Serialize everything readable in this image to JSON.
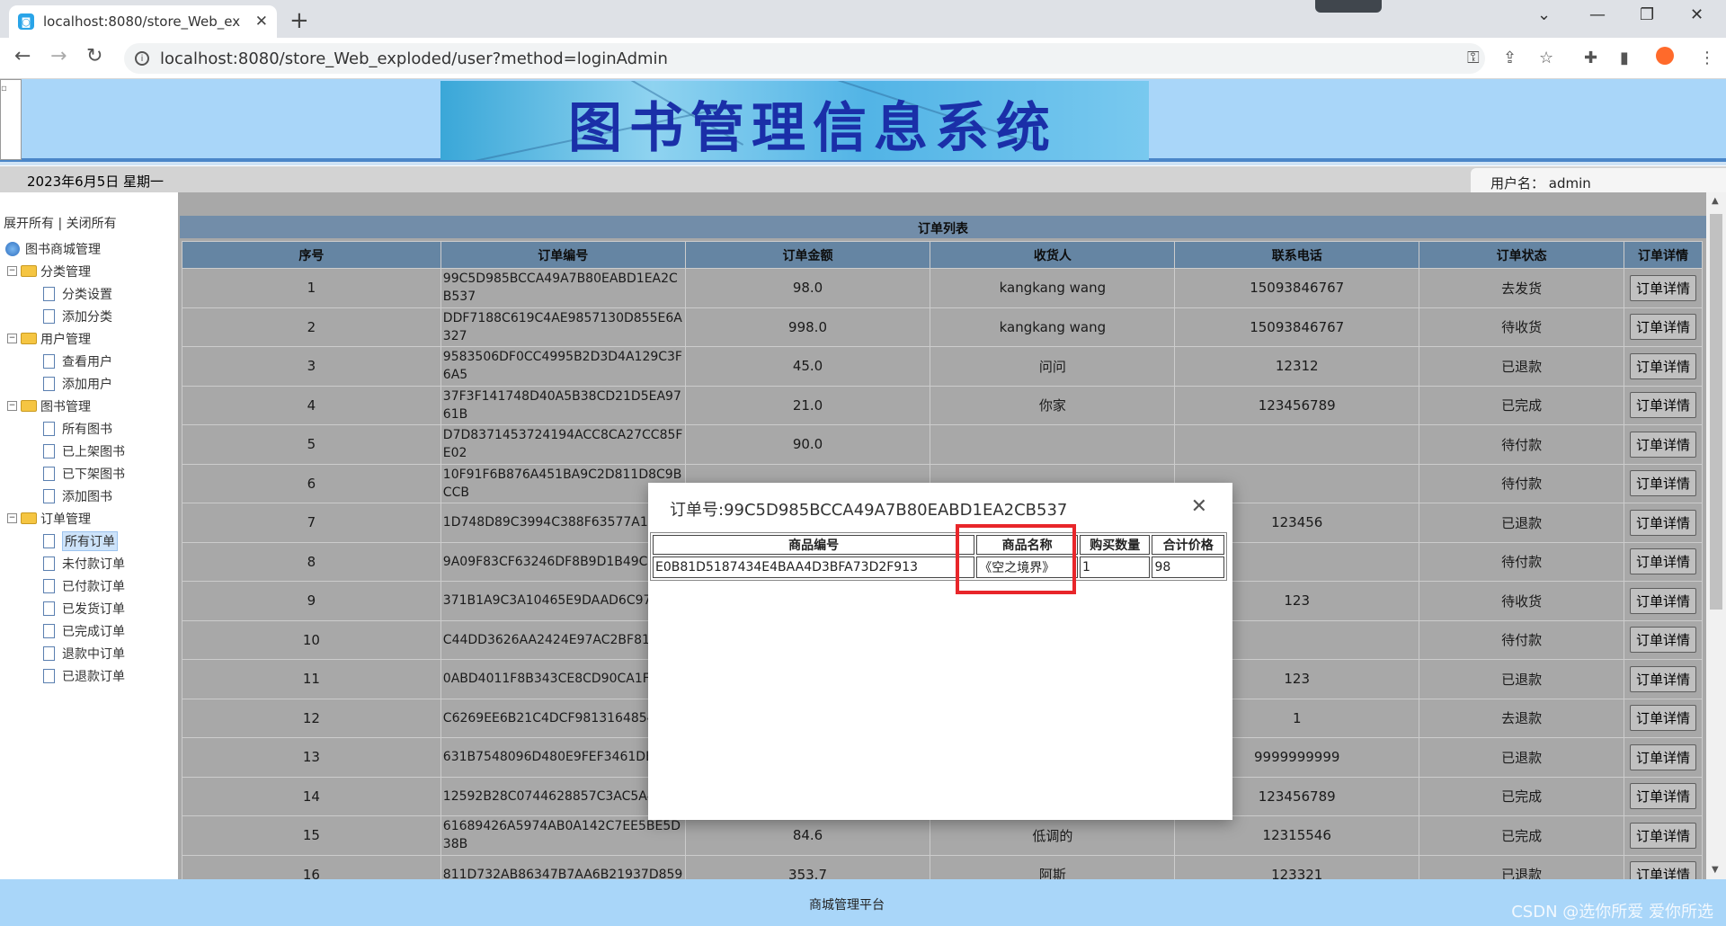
{
  "browser": {
    "tab_title": "localhost:8080/store_Web_exp",
    "url": "localhost:8080/store_Web_exploded/user?method=loginAdmin"
  },
  "header": {
    "banner_title": "图书管理信息系统",
    "date": "2023年6月5日 星期一",
    "user_label": "用户名：",
    "username": "admin"
  },
  "sidebar": {
    "expand_all": "展开所有",
    "separator": "|",
    "collapse_all": "关闭所有",
    "root": "图书商城管理",
    "groups": [
      {
        "label": "分类管理",
        "items": [
          "分类设置",
          "添加分类"
        ]
      },
      {
        "label": "用户管理",
        "items": [
          "查看用户",
          "添加用户"
        ]
      },
      {
        "label": "图书管理",
        "items": [
          "所有图书",
          "已上架图书",
          "已下架图书",
          "添加图书"
        ]
      },
      {
        "label": "订单管理",
        "items": [
          "所有订单",
          "未付款订单",
          "已付款订单",
          "已发货订单",
          "已完成订单",
          "退款中订单",
          "已退款订单"
        ]
      }
    ]
  },
  "orders": {
    "title": "订单列表",
    "columns": [
      "序号",
      "订单编号",
      "订单金额",
      "收货人",
      "联系电话",
      "订单状态",
      "订单详情"
    ],
    "detail_button": "订单详情",
    "rows": [
      {
        "no": "1",
        "id": "99C5D985BCCA49A7B80EABD1EA2CB537",
        "amount": "98.0",
        "receiver": "kangkang wang",
        "phone": "15093846767",
        "status": "去发货"
      },
      {
        "no": "2",
        "id": "DDF7188C619C4AE9857130D855E6A327",
        "amount": "998.0",
        "receiver": "kangkang wang",
        "phone": "15093846767",
        "status": "待收货"
      },
      {
        "no": "3",
        "id": "9583506DF0CC4995B2D3D4A129C3F6A5",
        "amount": "45.0",
        "receiver": "问问",
        "phone": "12312",
        "status": "已退款"
      },
      {
        "no": "4",
        "id": "37F3F141748D40A5B38CD21D5EA9761B",
        "amount": "21.0",
        "receiver": "你家",
        "phone": "123456789",
        "status": "已完成"
      },
      {
        "no": "5",
        "id": "D7D8371453724194ACC8CA27CC85FE02",
        "amount": "90.0",
        "receiver": "",
        "phone": "",
        "status": "待付款"
      },
      {
        "no": "6",
        "id": "10F91F6B876A451BA9C2D811D8C9BCCB",
        "amount": "",
        "receiver": "",
        "phone": "",
        "status": "待付款"
      },
      {
        "no": "7",
        "id": "1D748D89C3994C388F63577A1C03",
        "amount": "",
        "receiver": "",
        "phone": "123456",
        "status": "已退款"
      },
      {
        "no": "8",
        "id": "9A09F83CF63246DF8B9D1B49C3B3",
        "amount": "",
        "receiver": "",
        "phone": "",
        "status": "待付款"
      },
      {
        "no": "9",
        "id": "371B1A9C3A10465E9DAAD6C971F",
        "amount": "",
        "receiver": "",
        "phone": "123",
        "status": "待收货"
      },
      {
        "no": "10",
        "id": "C44DD3626AA2424E97AC2BF8190B",
        "amount": "",
        "receiver": "",
        "phone": "",
        "status": "待付款"
      },
      {
        "no": "11",
        "id": "0ABD4011F8B343CE8CD90CA1F49",
        "amount": "",
        "receiver": "",
        "phone": "123",
        "status": "已退款"
      },
      {
        "no": "12",
        "id": "C6269EE6B21C4DCF981316485456",
        "amount": "",
        "receiver": "",
        "phone": "1",
        "status": "去退款"
      },
      {
        "no": "13",
        "id": "631B7548096D480E9FEF3461DE56",
        "amount": "",
        "receiver": "",
        "phone": "9999999999",
        "status": "已退款"
      },
      {
        "no": "14",
        "id": "12592B28C0744628857C3AC5A408",
        "amount": "",
        "receiver": "",
        "phone": "123456789",
        "status": "已完成"
      },
      {
        "no": "15",
        "id": "61689426A5974AB0A142C7EE5BE5D38B",
        "amount": "84.6",
        "receiver": "低调的",
        "phone": "12315546",
        "status": "已完成"
      },
      {
        "no": "16",
        "id": "811D732AB86347B7AA6B21937D859",
        "amount": "353.7",
        "receiver": "阿斯",
        "phone": "123321",
        "status": "已退款"
      }
    ]
  },
  "modal": {
    "title": "订单号:99C5D985BCCA49A7B80EABD1EA2CB537",
    "columns": [
      "商品编号",
      "商品名称",
      "购买数量",
      "合计价格"
    ],
    "items": [
      {
        "code": "E0B81D5187434E4BAA4D3BFA73D2F913",
        "name": "《空之境界》",
        "qty": "1",
        "total": "98"
      }
    ]
  },
  "footer": {
    "text": "商城管理平台",
    "watermark": "CSDN @选你所爱 爱你所选"
  },
  "colors": {
    "header_bg": "#a9d6f9",
    "table_header": "#7fa7cc",
    "status_red": "#e02020",
    "highlight": "#e8262a"
  }
}
